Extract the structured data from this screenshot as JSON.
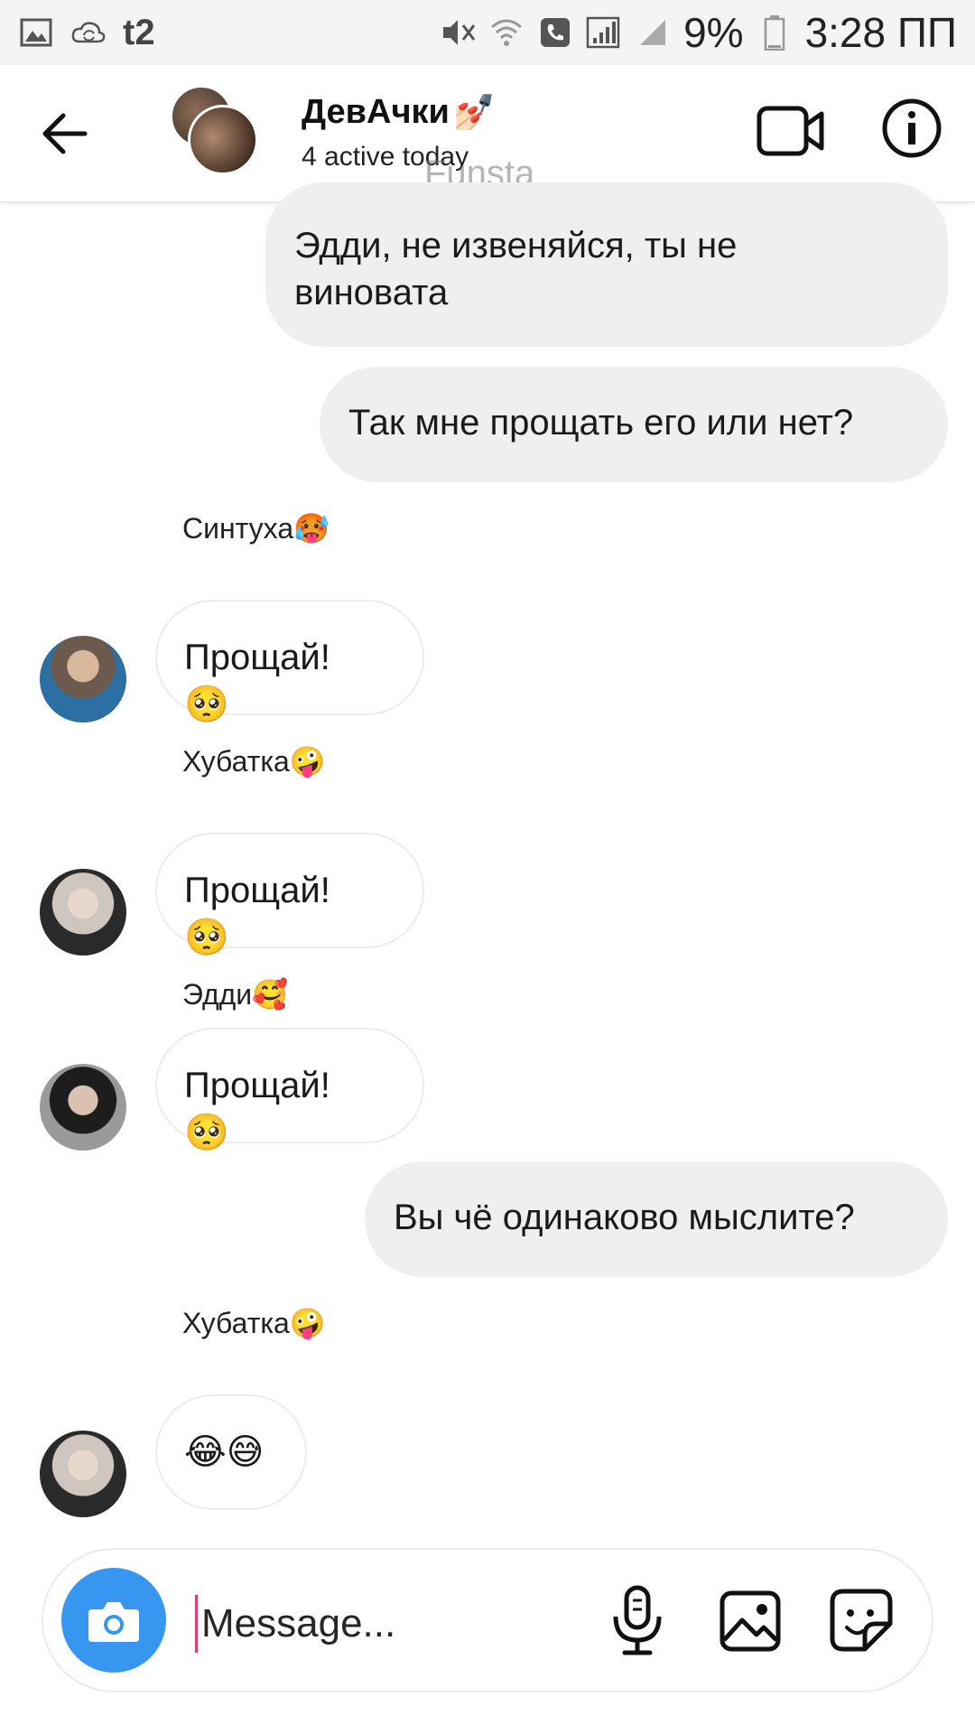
{
  "status_bar": {
    "carrier": "t2",
    "battery": "9%",
    "time": "3:28 ПП"
  },
  "header": {
    "group_name": "ДевАчки",
    "group_emoji": "💅🏻",
    "active_status": "4 active today",
    "watermark": "Funsta"
  },
  "messages": [
    {
      "type": "outgoing",
      "lines": [
        "Эдди, не извеняйся, ты не",
        "виновата"
      ]
    },
    {
      "type": "outgoing",
      "lines": [
        "Так мне прощать его или нет?"
      ]
    },
    {
      "type": "sender",
      "text": "Синтуха",
      "emoji": "🥵"
    },
    {
      "type": "incoming",
      "text": "Прощай!",
      "emoji": "🥺"
    },
    {
      "type": "sender",
      "text": "Хубатка",
      "emoji": "🤪"
    },
    {
      "type": "incoming",
      "text": "Прощай!",
      "emoji": "🥺"
    },
    {
      "type": "sender",
      "text": "Эдди",
      "emoji": "🥰"
    },
    {
      "type": "incoming",
      "text": "Прощай!",
      "emoji": "🥺"
    },
    {
      "type": "outgoing",
      "lines": [
        "Вы чё одинаково мыслите?"
      ]
    },
    {
      "type": "sender",
      "text": "Хубатка",
      "emoji": "🤪"
    },
    {
      "type": "incoming",
      "text": "",
      "emoji": "😂😅"
    }
  ],
  "composer": {
    "placeholder": "Message..."
  },
  "icons": {
    "back": "arrow-left-icon",
    "video": "video-camera-icon",
    "info": "info-icon",
    "camera": "camera-icon",
    "mic": "microphone-icon",
    "gallery": "image-icon",
    "sticker": "sticker-icon"
  },
  "colors": {
    "camera_button": "#3797f0",
    "outgoing_bubble": "#efeff0",
    "cursor": "#e23d7b"
  }
}
